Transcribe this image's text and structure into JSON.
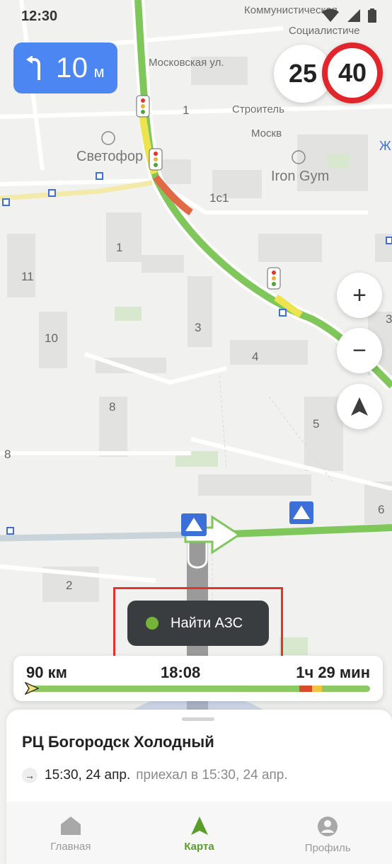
{
  "status_bar": {
    "time": "12:30"
  },
  "maneuver": {
    "distance": "10",
    "unit": "м",
    "icon": "turn-left-icon"
  },
  "speed": {
    "current": "25",
    "limit": "40"
  },
  "map": {
    "streets": [
      "Коммунистическая",
      "Социалистиче",
      "Московская ул.",
      "Строитель",
      "Москв",
      "Ж"
    ],
    "pois": [
      "Светофор",
      "Iron Gym"
    ],
    "buildings": [
      "1",
      "1с1",
      "1",
      "11",
      "3",
      "10",
      "4",
      "8",
      "5",
      "8",
      "6",
      "2",
      "3"
    ]
  },
  "controls": {
    "zoom_in": "+",
    "zoom_out": "−"
  },
  "gas_button": {
    "label": "Найти АЗС"
  },
  "route": {
    "distance": "90 км",
    "eta": "18:08",
    "time_left": "1ч 29 мин",
    "progress": 0.01,
    "colors": {
      "free": "#8cc863",
      "jam": "#d84a2a",
      "slow": "#f0c43e"
    }
  },
  "destination": {
    "name": "РЦ Богородск Холодный",
    "arrival": "15:30, 24 апр.",
    "arrival_note": "приехал в 15:30, 24 апр."
  },
  "tabs": [
    {
      "label": "Главная",
      "icon": "home-icon",
      "active": false
    },
    {
      "label": "Карта",
      "icon": "navigation-arrow-icon",
      "active": true
    },
    {
      "label": "Профиль",
      "icon": "profile-icon",
      "active": false
    }
  ]
}
